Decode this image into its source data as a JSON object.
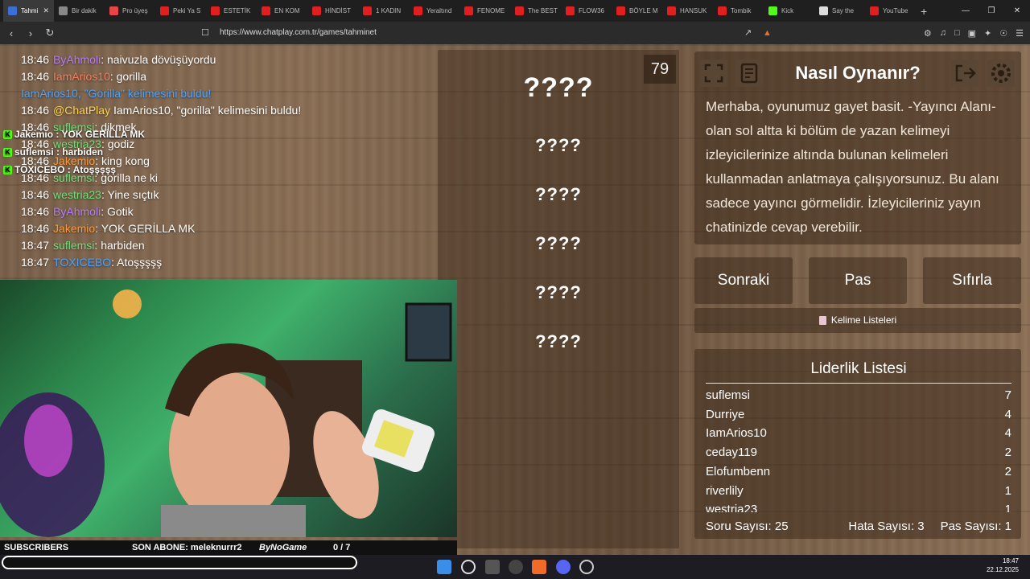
{
  "browser": {
    "tabs": [
      {
        "label": "Tahmi",
        "color": "#3a6fd8",
        "active": true
      },
      {
        "label": "Bir dakik",
        "color": "#888888"
      },
      {
        "label": "Pro üyeş",
        "color": "#e84646"
      },
      {
        "label": "Peki Ya S",
        "color": "#e02020"
      },
      {
        "label": "ESTETİK",
        "color": "#e02020"
      },
      {
        "label": "EN KOM",
        "color": "#e02020"
      },
      {
        "label": "HİNDİST",
        "color": "#e02020"
      },
      {
        "label": "1 KADIN",
        "color": "#e02020"
      },
      {
        "label": "Yeraltınd",
        "color": "#e02020"
      },
      {
        "label": "FENOME",
        "color": "#e02020"
      },
      {
        "label": "The BEST",
        "color": "#e02020"
      },
      {
        "label": "FLOW36",
        "color": "#e02020"
      },
      {
        "label": "BÖYLE M",
        "color": "#e02020"
      },
      {
        "label": "HANSUK",
        "color": "#e02020"
      },
      {
        "label": "Tombik",
        "color": "#e02020"
      },
      {
        "label": "Kick",
        "color": "#53fc18"
      },
      {
        "label": "Say the",
        "color": "#dddddd"
      },
      {
        "label": "YouTube",
        "color": "#e02020"
      }
    ],
    "url": "https://www.chatplay.com.tr/games/tahminet"
  },
  "chat": [
    {
      "time": "18:46",
      "user": "ByAhmoli",
      "ucolor": "#b77aff",
      "msg": "naivuzla dövüşüyordu"
    },
    {
      "time": "18:46",
      "user": "IamArios10",
      "ucolor": "#ff7b5a",
      "msg": "gorilla"
    },
    {
      "time": "",
      "user": "IamArios10, \"Gorilla\" kelimesini buldu!",
      "ucolor": "#4aa3ff",
      "msg": ""
    },
    {
      "time": "18:46",
      "user": "@ChatPlay",
      "ucolor": "#ffd24a",
      "msg": "IamArios10, \"gorilla\" kelimesini buldu!"
    },
    {
      "time": "18:46",
      "user": "suflemsi",
      "ucolor": "#6fe07a",
      "msg": "dikmek"
    },
    {
      "time": "18:46",
      "user": "westria23",
      "ucolor": "#6fe07a",
      "msg": "godiz"
    },
    {
      "time": "18:46",
      "user": "Jakemio",
      "ucolor": "#ff9a3a",
      "msg": "king kong"
    },
    {
      "time": "18:46",
      "user": "suflemsi",
      "ucolor": "#6fe07a",
      "msg": "gorilla ne ki"
    },
    {
      "time": "18:46",
      "user": "westria23",
      "ucolor": "#6fe07a",
      "msg": "Yine sıçtık"
    },
    {
      "time": "18:46",
      "user": "ByAhmoli",
      "ucolor": "#b77aff",
      "msg": "Gotik"
    },
    {
      "time": "18:46",
      "user": "Jakemio",
      "ucolor": "#ff9a3a",
      "msg": "YOK GERİLLA MK"
    },
    {
      "time": "18:47",
      "user": "suflemsi",
      "ucolor": "#6fe07a",
      "msg": "harbiden"
    },
    {
      "time": "18:47",
      "user": "TOXICEBO",
      "ucolor": "#4aa3ff",
      "msg": "Atoşşşşş"
    }
  ],
  "overlay_chat": [
    {
      "text": "Jakemio : YOK GERİLLA MK"
    },
    {
      "text": "suflemsi : harbiden"
    },
    {
      "text": "TOXICEBO : Atoşşşşş"
    }
  ],
  "game": {
    "counter": "79",
    "words": [
      "????",
      "????",
      "????",
      "????",
      "????",
      "????"
    ],
    "howto_title": "Nasıl Oynanır?",
    "howto_text": "Merhaba, oyunumuz gayet basit. -Yayıncı Alanı- olan sol altta ki bölüm de yazan kelimeyi izleyicilerinize altında bulunan kelimeleri kullanmadan anlatmaya çalışıyorsunuz. Bu alanı sadece yayıncı görmelidir. İzleyicileriniz yayın chatinizde cevap verebilir.",
    "buttons": {
      "next": "Sonraki",
      "pass": "Pas",
      "reset": "Sıfırla"
    },
    "word_lists": "Kelime Listeleri",
    "leaderboard_title": "Liderlik Listesi",
    "leaderboard": [
      {
        "name": "suflemsi",
        "score": "7"
      },
      {
        "name": "Durriye",
        "score": "4"
      },
      {
        "name": "IamArios10",
        "score": "4"
      },
      {
        "name": "ceday119",
        "score": "2"
      },
      {
        "name": "Elofumbenn",
        "score": "2"
      },
      {
        "name": "riverlily",
        "score": "1"
      },
      {
        "name": "westria23",
        "score": "1"
      }
    ],
    "stats": {
      "questions": "Soru Sayısı: 25",
      "errors": "Hata Sayısı: 3",
      "passes": "Pas Sayısı: 1"
    }
  },
  "streambar": {
    "subscribers": "SUBSCRIBERS",
    "last_sub": "SON ABONE: meleknurrr2",
    "brand": "ByNoGame",
    "goal": "0 / 7"
  },
  "taskbar": {
    "time": "18:47",
    "date": "22.12.2025"
  }
}
